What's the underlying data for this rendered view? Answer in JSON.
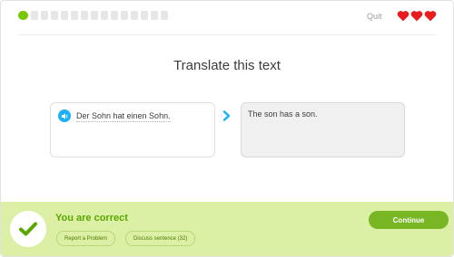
{
  "header": {
    "progress": {
      "completed": 1,
      "total": 15
    },
    "quit_label": "Quit",
    "hearts": {
      "count": 3,
      "color": "#e81c1c"
    }
  },
  "prompt": {
    "title": "Translate this text"
  },
  "source": {
    "text": "Der Sohn hat einen Sohn.",
    "icon": "speaker-icon"
  },
  "answer": {
    "text": "The son has a son."
  },
  "result": {
    "message": "You are correct",
    "report_label": "Report a Problem",
    "discuss_label": "Discuss sentence (32)",
    "continue_label": "Continue",
    "colors": {
      "banner": "#dcf0a5",
      "accent": "#58a700",
      "button": "#78b624"
    }
  }
}
